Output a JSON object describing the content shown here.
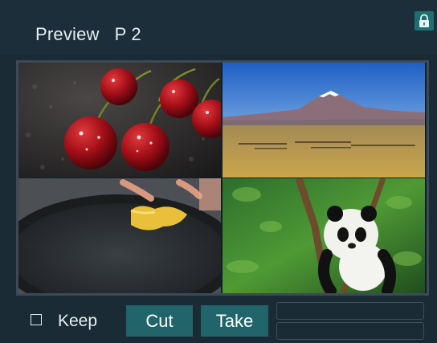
{
  "panel": {
    "title": "Preview   P 2",
    "lock_icon": "lock-icon"
  },
  "preview_grid": {
    "cells": [
      {
        "name": "cherries",
        "description_icon": "image-thumbnail"
      },
      {
        "name": "mountain-plain",
        "description_icon": "image-thumbnail"
      },
      {
        "name": "cooking-pan",
        "description_icon": "image-thumbnail"
      },
      {
        "name": "panda",
        "description_icon": "image-thumbnail"
      }
    ]
  },
  "footer": {
    "keep_label": "Keep",
    "cut_label": "Cut",
    "take_label": "Take",
    "field1_value": "",
    "field2_value": ""
  },
  "colors": {
    "accent": "#21656a",
    "background": "#1b2b36",
    "text": "#e6eef2"
  }
}
